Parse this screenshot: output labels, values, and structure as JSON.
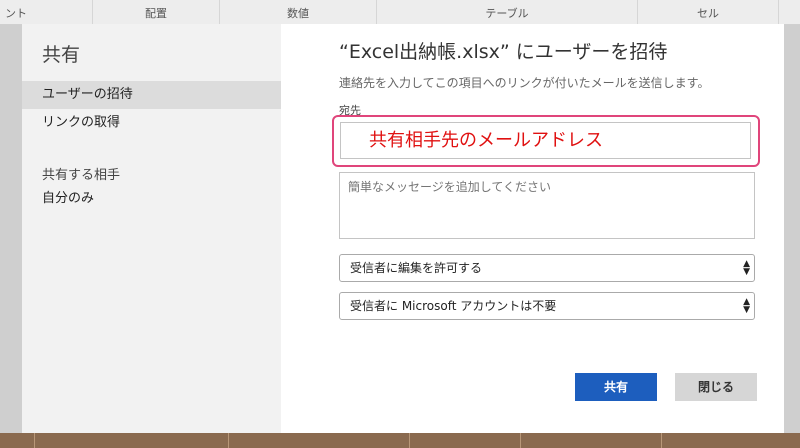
{
  "ribbon": {
    "labels": [
      "ント",
      "配置",
      "数値",
      "テーブル",
      "セル"
    ]
  },
  "sidebar": {
    "title": "共有",
    "items": [
      {
        "label": "ユーザーの招待"
      },
      {
        "label": "リンクの取得"
      }
    ],
    "section_title": "共有する相手",
    "section_value": "自分のみ"
  },
  "main": {
    "title": "“Excel出納帳.xlsx” にユーザーを招待",
    "subtitle": "連絡先を入力してこの項目へのリンクが付いたメールを送信します。",
    "to_label": "宛先",
    "to_value": "共有相手先のメールアドレス",
    "message_placeholder": "簡単なメッセージを追加してください",
    "permission_select": "受信者に編集を許可する",
    "account_select": "受信者に Microsoft アカウントは不要",
    "share_button": "共有",
    "close_button": "閉じる"
  },
  "colors": {
    "highlight_border": "#e0457b",
    "to_text": "#e01010",
    "share_button": "#1d5ebe"
  }
}
